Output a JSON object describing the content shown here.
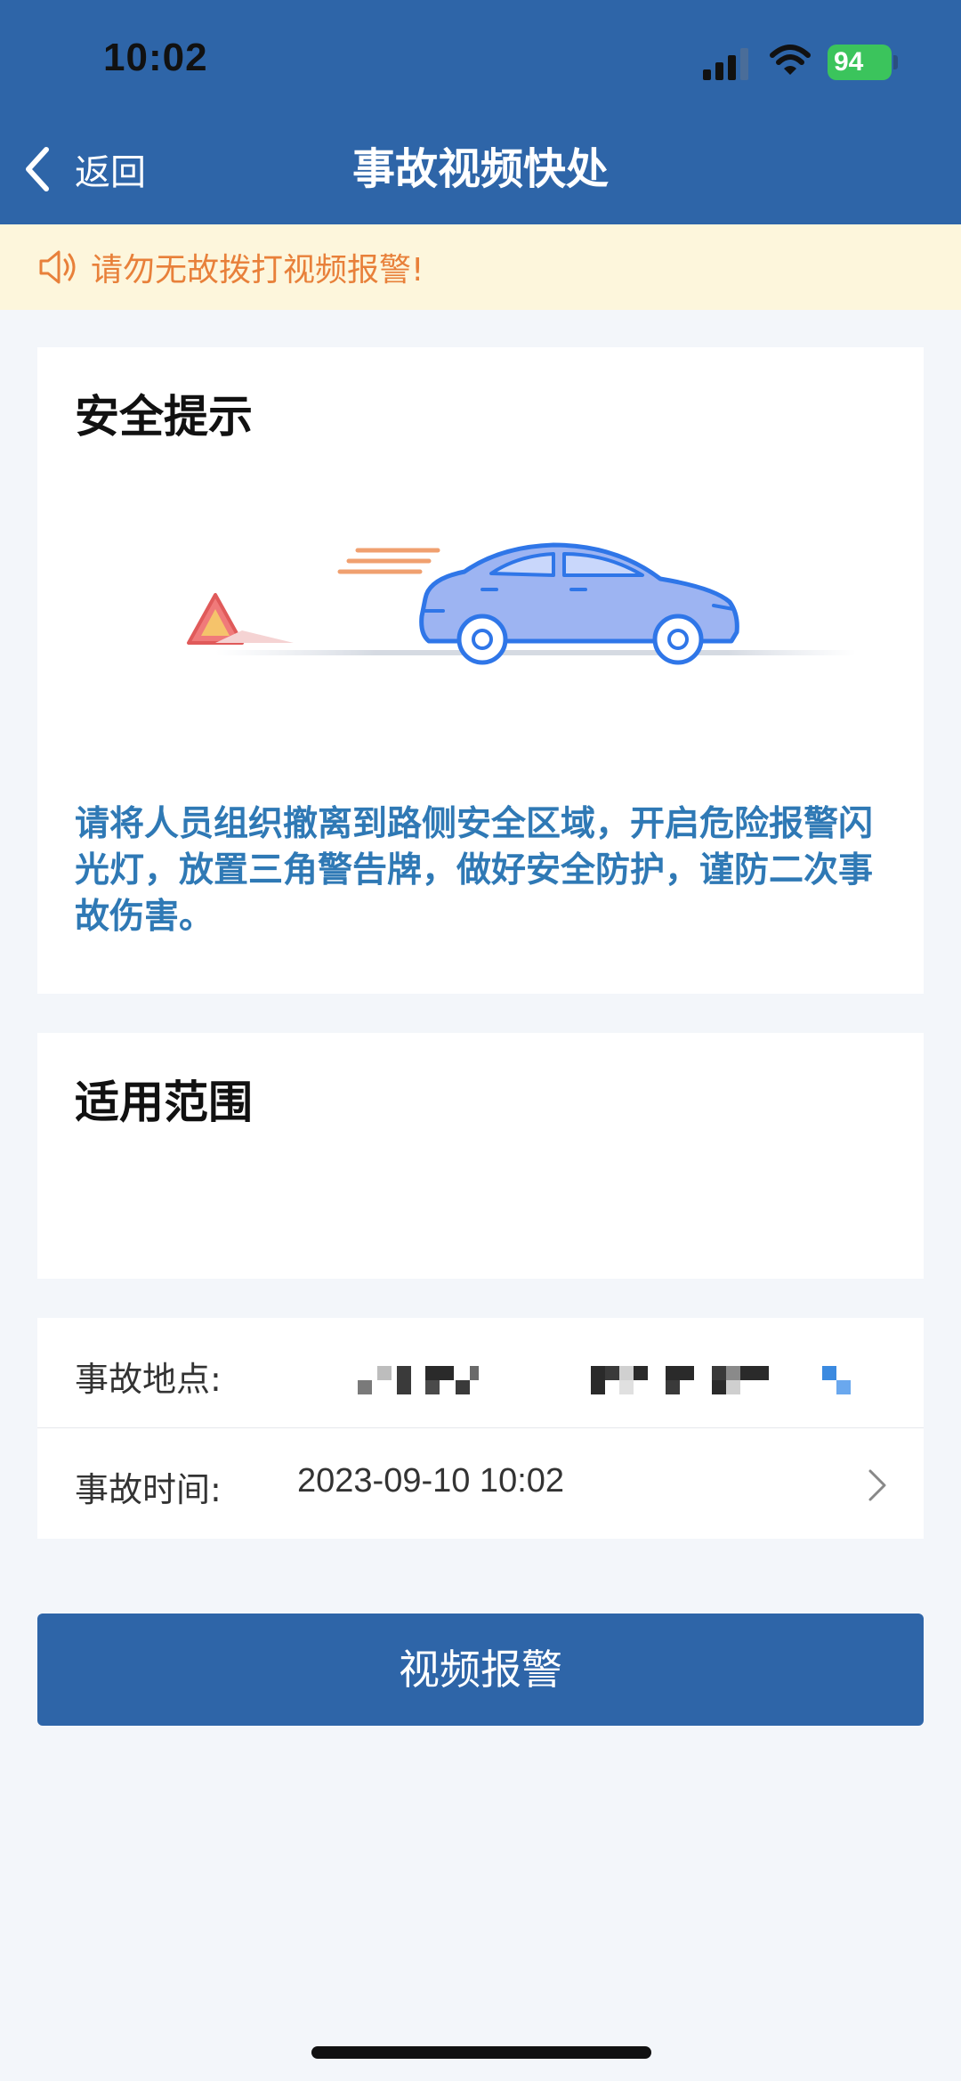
{
  "status_bar": {
    "time": "10:02",
    "battery": "94"
  },
  "nav": {
    "back_label": "返回",
    "title": "事故视频快处"
  },
  "notice": {
    "text": "请勿无故拨打视频报警!"
  },
  "safety_card": {
    "title": "安全提示",
    "text": "请将人员组织撤离到路侧安全区域，开启危险报警闪光灯，放置三角警告牌，做好安全防护，谨防二次事故伤害。"
  },
  "scope_card": {
    "title": "适用范围"
  },
  "form": {
    "location_label": "事故地点:",
    "time_label": "事故时间:",
    "time_value": "2023-09-10 10:02"
  },
  "video_button_label": "视频报警",
  "colors": {
    "primary": "#2e65a8",
    "notice_bg": "#fdf6dc",
    "notice_text": "#e8803a",
    "safety_text": "#2f79b5",
    "battery": "#3bc45c"
  }
}
